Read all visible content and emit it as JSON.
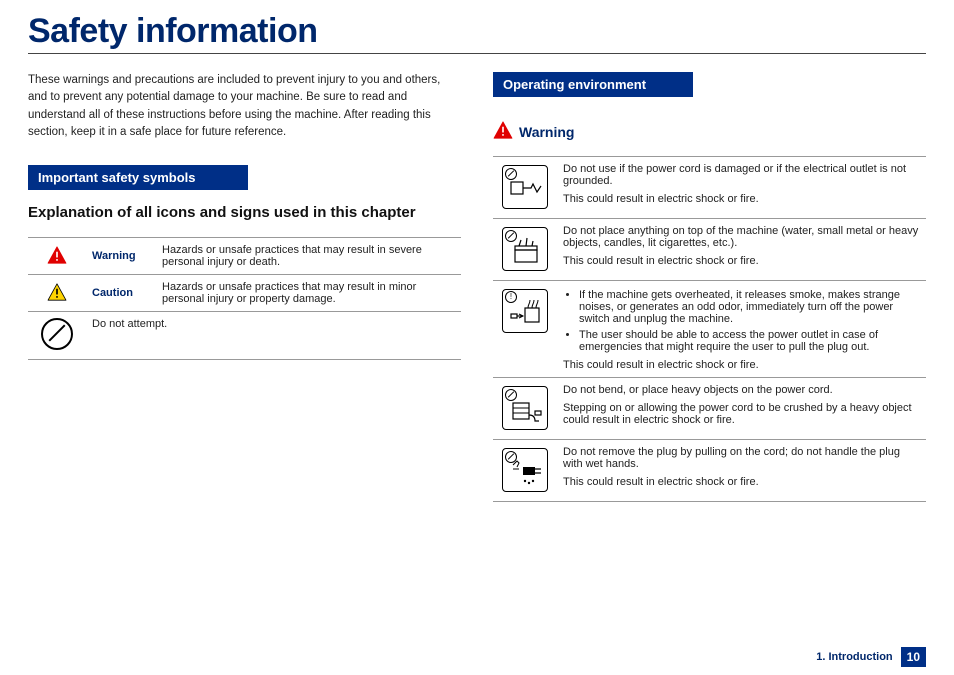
{
  "title": "Safety information",
  "intro": "These warnings and precautions are included to prevent injury to you and others, and to prevent any potential damage to your machine. Be sure to read and understand all of these instructions before using the machine. After reading this section, keep it in a safe place for future reference.",
  "sections": {
    "symbols": {
      "heading": "Important safety symbols",
      "sub": "Explanation of all icons and signs used in this chapter",
      "rows": {
        "warning": {
          "label": "Warning",
          "text": "Hazards or unsafe practices that may result in severe personal injury or death."
        },
        "caution": {
          "label": "Caution",
          "text": "Hazards or unsafe practices that may result in minor personal injury or property damage."
        },
        "donot": {
          "text": "Do not attempt."
        }
      }
    },
    "operating": {
      "heading": "Operating environment",
      "warning_label": "Warning",
      "rows": {
        "r1": {
          "main": "Do not use if the power cord is damaged or if the electrical outlet is not grounded.",
          "foot": "This could result in electric shock or fire."
        },
        "r2": {
          "main": "Do not place anything on top of the machine (water, small metal or heavy objects, candles, lit cigarettes, etc.).",
          "foot": "This could result in electric shock or fire."
        },
        "r3": {
          "b1": "If the machine gets overheated, it releases smoke, makes strange noises, or generates an odd odor, immediately turn off the power switch and unplug the machine.",
          "b2": "The user should be able to access the power outlet in case of emergencies that might require the user to pull the plug out.",
          "foot": "This could result in electric shock or fire."
        },
        "r4": {
          "l1": "Do not bend, or place heavy objects on the power cord.",
          "l2": "Stepping on or allowing the power cord to be crushed by a heavy object could result in electric shock or fire."
        },
        "r5": {
          "main": "Do not remove the plug by pulling on the cord; do not handle the plug with wet hands.",
          "foot": "This could result in electric shock or fire."
        }
      }
    }
  },
  "footer": {
    "chapter": "1. Introduction",
    "page": "10"
  }
}
